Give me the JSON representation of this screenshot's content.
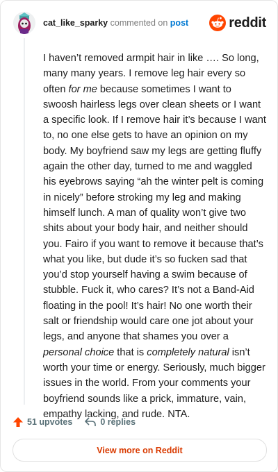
{
  "comment": {
    "username": "cat_like_sparky",
    "action_text": "commented on",
    "post_link": "post",
    "body_segments": [
      {
        "text": "I haven’t removed armpit hair in like …. So long, many many years. I remove leg hair every so often ",
        "style": "normal"
      },
      {
        "text": "for me",
        "style": "italic"
      },
      {
        "text": " because sometimes I want to swoosh hairless legs over clean sheets or I want a specific look. If I remove hair it’s because I want to, no one else gets to have an opinion on my body. My boyfriend saw my legs are getting fluffy again the other day, turned to me and waggled his eyebrows saying “ah the winter pelt is coming in nicely” before stroking my leg and making himself lunch. A man of quality won’t give two shits about your body hair, and neither should you. Fairo if you want to remove it because that’s what you like, but dude it’s so fucken sad that you’d stop yourself having a swim because of stubble. Fuck it, who cares? It’s not a Band-Aid floating in the pool! It’s hair! No one worth their salt or friendship would care one jot about your legs, and anyone that shames you over a ",
        "style": "normal"
      },
      {
        "text": "personal choice",
        "style": "italic"
      },
      {
        "text": " that is ",
        "style": "normal"
      },
      {
        "text": "completely natural",
        "style": "italic"
      },
      {
        "text": " isn’t worth your time or energy. Seriously, much bigger issues in the world. From your comments your boyfriend sounds like a prick, immature, vain, empathy lacking, and rude. NTA.",
        "style": "normal"
      }
    ],
    "upvotes_label": "51 upvotes",
    "replies_label": "0 replies"
  },
  "brand": {
    "wordmark": "reddit",
    "color": "#ff4500"
  },
  "cta": {
    "view_more_label": "View more on Reddit"
  },
  "icons": {
    "avatar": "avatar-icon",
    "logo": "reddit-logo-icon",
    "upvote": "upvote-arrow-icon",
    "reply": "reply-arrow-icon"
  },
  "colors": {
    "upvote_accent": "#ff4500",
    "link": "#0079d3",
    "cta_text": "#d93a00"
  }
}
